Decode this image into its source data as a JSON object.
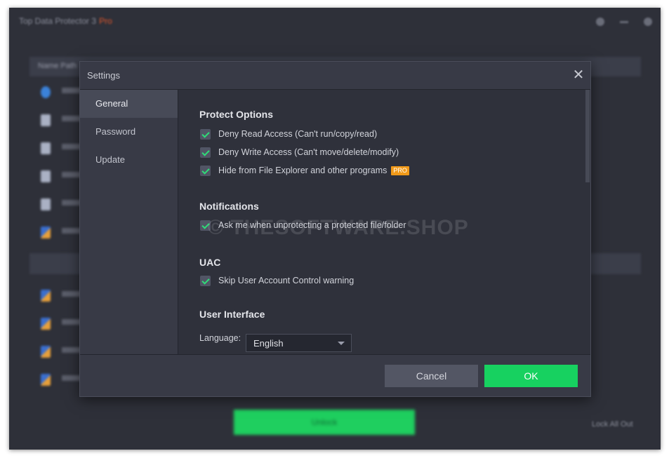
{
  "app": {
    "title": "Top Data Protector 3",
    "title_badge": "Pro",
    "unlock_label": "Unlock",
    "lock_all_label": "Lock All Out",
    "table_header": "Name  Path"
  },
  "dialog": {
    "title": "Settings",
    "close_label": "✕",
    "sidebar": [
      {
        "label": "General",
        "active": true
      },
      {
        "label": "Password",
        "active": false
      },
      {
        "label": "Update",
        "active": false
      }
    ],
    "sections": {
      "protect": {
        "title": "Protect Options",
        "options": [
          {
            "label": "Deny Read Access (Can't run/copy/read)",
            "checked": true
          },
          {
            "label": "Deny Write Access (Can't move/delete/modify)",
            "checked": true
          },
          {
            "label": "Hide from File Explorer and other programs",
            "checked": true,
            "badge": "PRO"
          }
        ]
      },
      "notifications": {
        "title": "Notifications",
        "options": [
          {
            "label": "Ask me when unprotecting a protected file/folder",
            "checked": true
          }
        ]
      },
      "uac": {
        "title": "UAC",
        "options": [
          {
            "label": "Skip User Account Control warning",
            "checked": true
          }
        ]
      },
      "ui": {
        "title": "User Interface",
        "language_label": "Language:",
        "language_value": "English"
      }
    },
    "footer": {
      "cancel_label": "Cancel",
      "ok_label": "OK"
    }
  },
  "watermark": "© THESOFTWARE.SHOP",
  "colors": {
    "accent": "#17d160",
    "check": "#2fdc78",
    "pro_badge": "#f29a19",
    "background": "#2e3039"
  }
}
